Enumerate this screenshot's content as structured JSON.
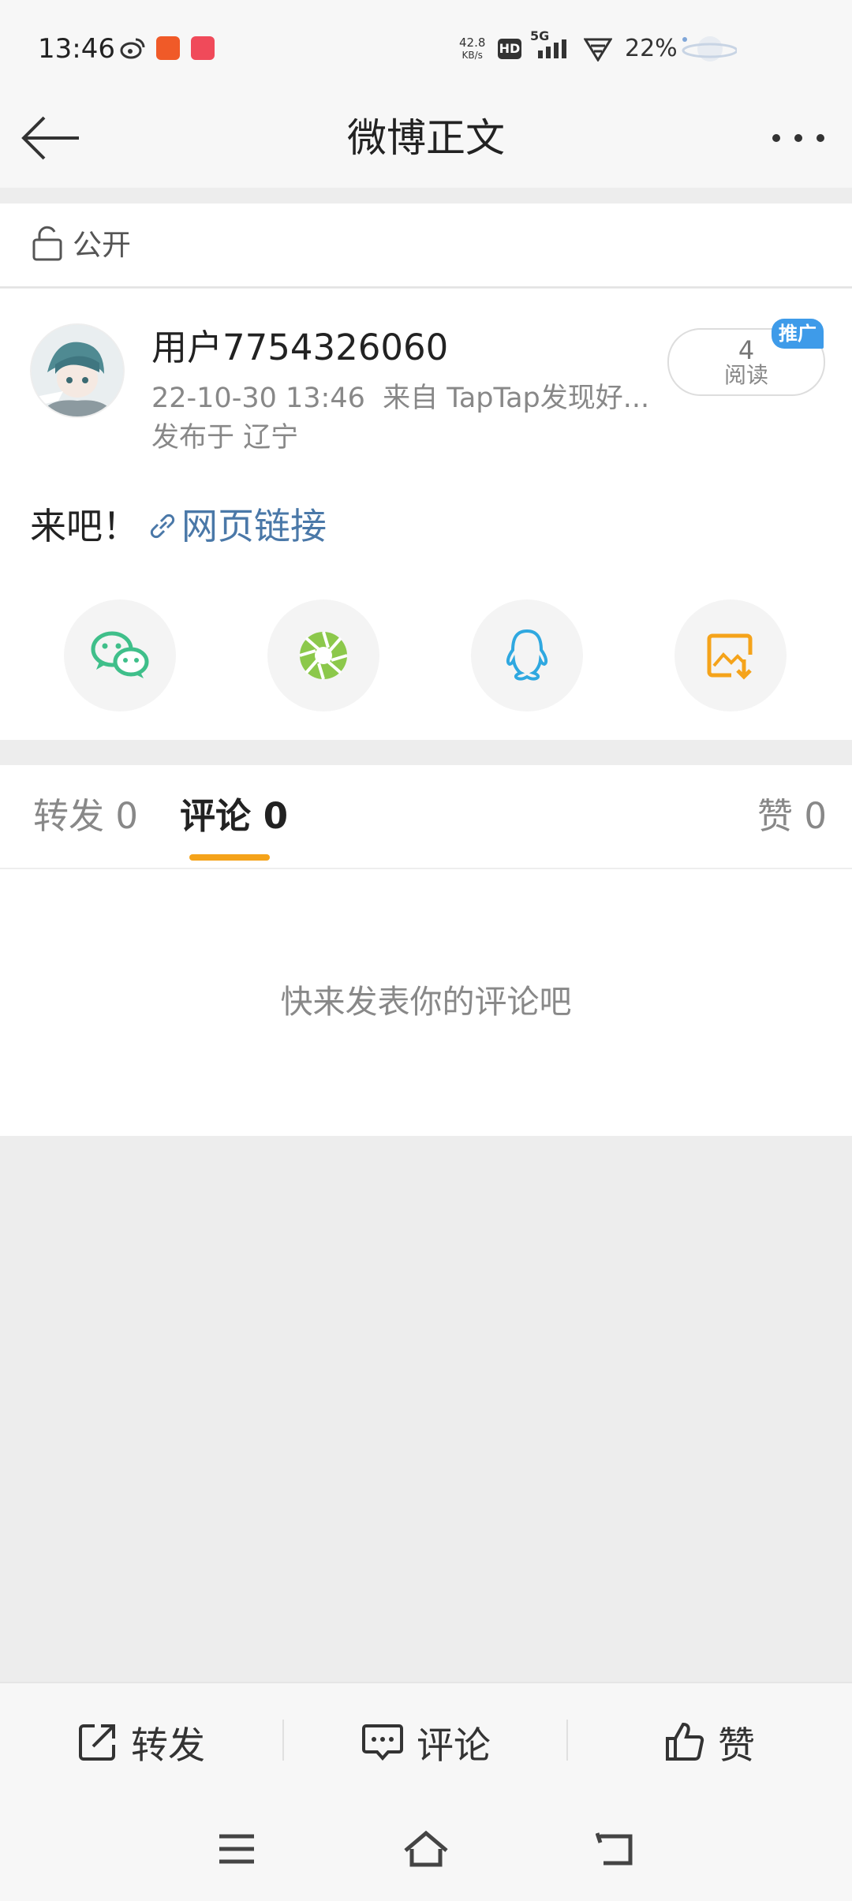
{
  "status_bar": {
    "time": "13:46",
    "speed_value": "42.8",
    "speed_unit": "KB/s",
    "hd": "HD",
    "network": "5G",
    "battery": "22%"
  },
  "header": {
    "title": "微博正文"
  },
  "visibility": {
    "label": "公开"
  },
  "post": {
    "username": "用户7754326060",
    "timestamp": "22-10-30 13:46",
    "source": "来自 TapTap发现好...",
    "location": "发布于 辽宁",
    "read_count": "4",
    "read_label": "阅读",
    "promo_badge": "推广",
    "text": "来吧！",
    "link_label": "网页链接"
  },
  "share_icons": [
    "wechat-icon",
    "moments-icon",
    "qq-icon",
    "save-image-icon"
  ],
  "tabs": [
    {
      "label": "转发",
      "count": "0"
    },
    {
      "label": "评论",
      "count": "0"
    },
    {
      "label": "赞",
      "count": "0"
    }
  ],
  "comments": {
    "empty_text": "快来发表你的评论吧"
  },
  "actions": {
    "repost": "转发",
    "comment": "评论",
    "like": "赞"
  },
  "colors": {
    "accent": "#f5a31a",
    "link": "#4a78a8",
    "promo": "#3e9be9"
  }
}
